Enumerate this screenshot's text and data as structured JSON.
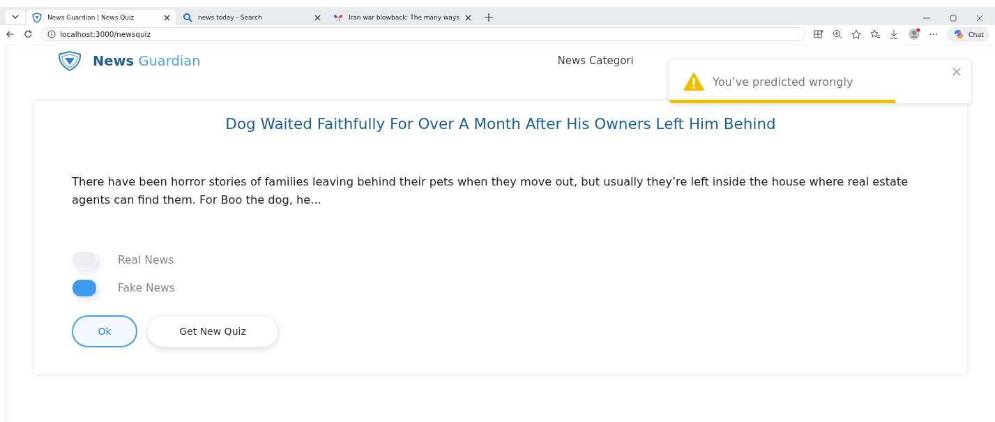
{
  "browser": {
    "tabs": [
      {
        "title": "News Guardian | News Quiz",
        "selected": true,
        "kind": "shield"
      },
      {
        "title": "news today - Search",
        "selected": false,
        "kind": "search"
      },
      {
        "title": "Iran war blowback: The many ways",
        "selected": false,
        "kind": "butterfly"
      }
    ],
    "address": "localhost:3000/newsquiz",
    "chat_label": "Chat"
  },
  "header": {
    "brand_first": "News",
    "brand_second": "Guardian",
    "nav_item": "News Categori"
  },
  "toast": {
    "message": "You’ve predicted wrongly",
    "level": 0.75
  },
  "quiz": {
    "title": "Dog Waited Faithfully For Over A Month After His Owners Left Him Behind",
    "body": "There have been horror stories of families leaving behind their pets when they move out, but usually they’re left inside the house where real estate agents can find them. For Boo the dog, he...",
    "options": [
      {
        "label": "Real News",
        "selected": false
      },
      {
        "label": "Fake News",
        "selected": true
      }
    ],
    "buttons": [
      {
        "label": "Ok",
        "kind": "primary"
      },
      {
        "label": "Get New Quiz",
        "kind": "secondary"
      }
    ]
  }
}
